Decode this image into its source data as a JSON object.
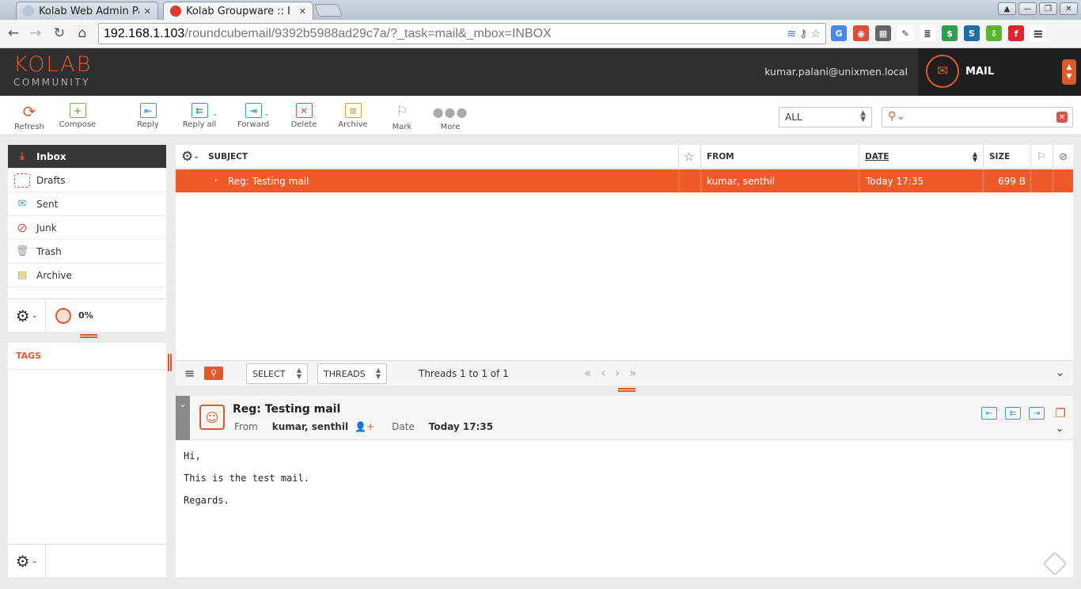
{
  "browser": {
    "tabs": [
      {
        "label": "Kolab Web Admin Pa",
        "close": "✕"
      },
      {
        "label": "Kolab Groupware :: I",
        "close": "✕"
      }
    ],
    "url_host": "192.168.1.103",
    "url_path": "/roundcubemail/9392b5988ad29c7a/?_task=mail&_mbox=INBOX",
    "window_buttons": [
      "▲",
      "—",
      "❐",
      "✕"
    ]
  },
  "app": {
    "logo_top": "KOLAB",
    "logo_bottom": "COMMUNITY",
    "user": "kumar.palani@unixmen.local",
    "module": "MAIL"
  },
  "toolbar": {
    "refresh": "Refresh",
    "compose": "Compose",
    "reply": "Reply",
    "reply_all": "Reply all",
    "forward": "Forward",
    "delete": "Delete",
    "archive": "Archive",
    "mark": "Mark",
    "more": "More",
    "filter": "ALL",
    "search_placeholder": ""
  },
  "folders": [
    {
      "label": "Inbox",
      "icon": "inbox-icon"
    },
    {
      "label": "Drafts",
      "icon": "drafts-icon"
    },
    {
      "label": "Sent",
      "icon": "sent-icon"
    },
    {
      "label": "Junk",
      "icon": "junk-icon"
    },
    {
      "label": "Trash",
      "icon": "trash-icon"
    },
    {
      "label": "Archive",
      "icon": "archive-icon"
    }
  ],
  "quota": "0%",
  "tags_title": "TAGS",
  "list": {
    "columns": {
      "subject": "SUBJECT",
      "from": "FROM",
      "date": "DATE",
      "size": "SIZE"
    },
    "rows": [
      {
        "subject": "Reg: Testing mail",
        "from": "kumar, senthil",
        "date": "Today 17:35",
        "size": "699 B"
      }
    ],
    "select": "SELECT",
    "threads": "THREADS",
    "count": "Threads 1 to 1 of 1"
  },
  "preview": {
    "subject": "Reg: Testing mail",
    "from_label": "From",
    "from": "kumar, senthil",
    "date_label": "Date",
    "date": "Today 17:35",
    "body": [
      "Hi,",
      "This is the test mail.",
      "Regards."
    ]
  },
  "colors": {
    "accent": "#e0592b",
    "selected_row": "#f05a28",
    "header": "#2f2f2f"
  }
}
